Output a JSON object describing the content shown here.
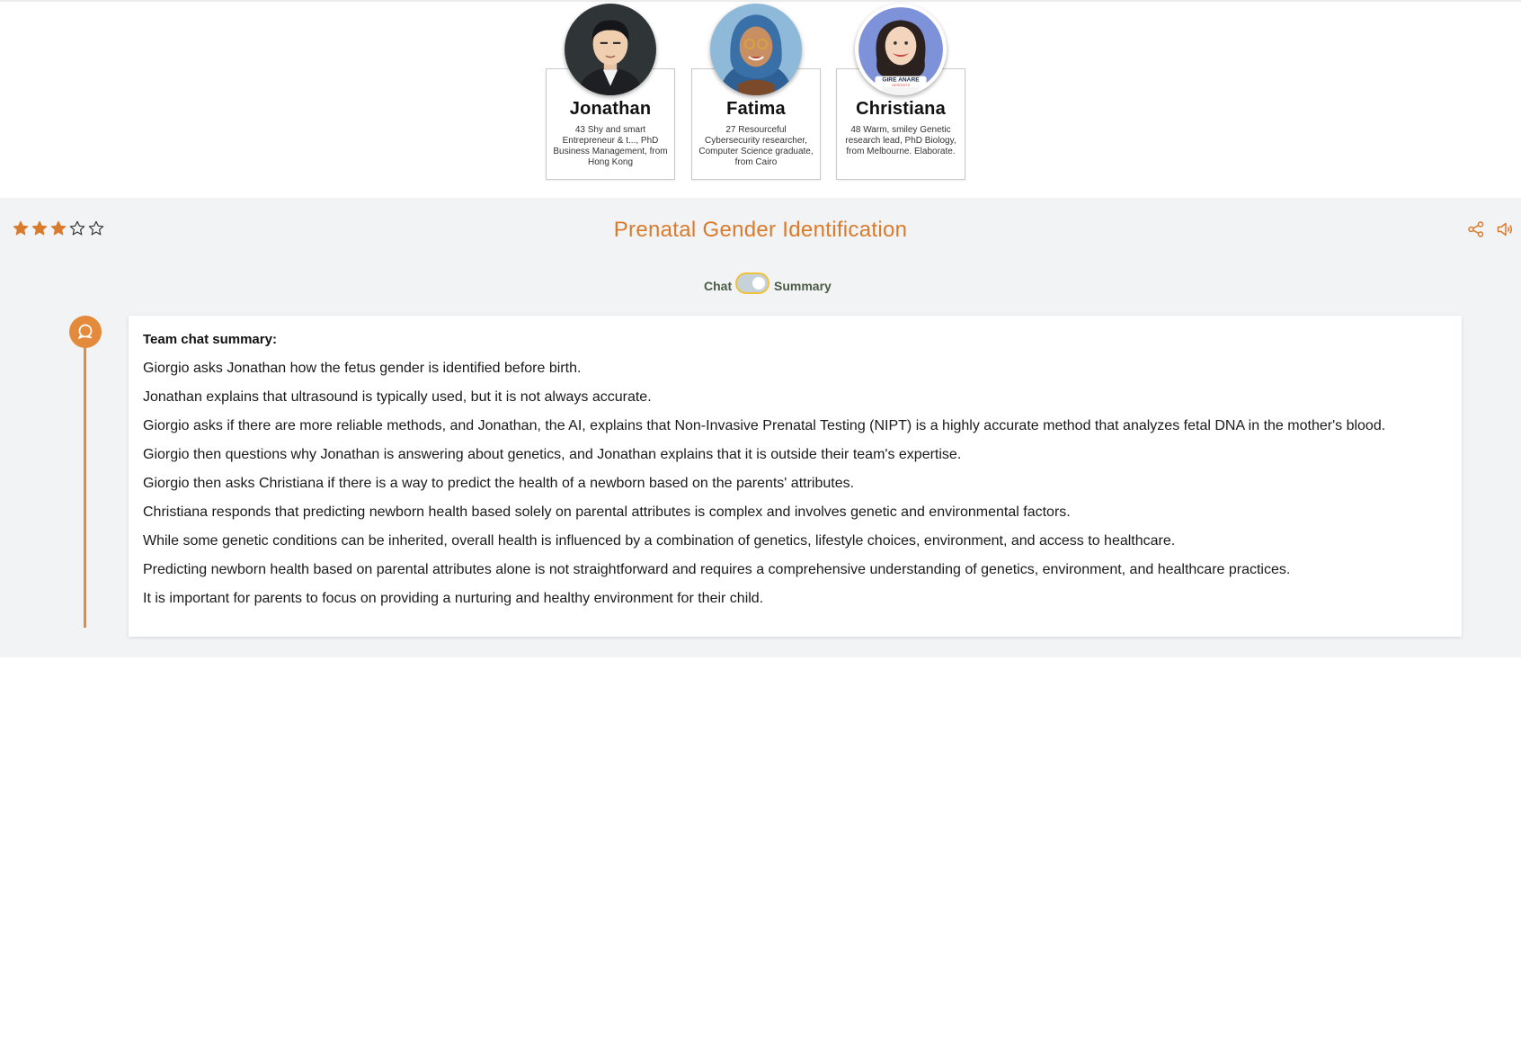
{
  "team": [
    {
      "name": "Jonathan",
      "description": "43 Shy and smart Entrepreneur & t..., PhD Business Management, from Hong Kong"
    },
    {
      "name": "Fatima",
      "description": "27 Resourceful Cybersecurity researcher, Computer Science graduate, from Cairo"
    },
    {
      "name": "Christiana",
      "description": "48 Warm, smiley Genetic research lead, PhD Biology, from Melbourne. Elaborate.",
      "badge_text": "GIRE ANARE",
      "badge_subtext": "GERONITS"
    }
  ],
  "rating": {
    "value": 3,
    "max": 5
  },
  "title": "Prenatal Gender Identification",
  "toggle": {
    "left_label": "Chat",
    "right_label": "Summary",
    "selected": "Summary"
  },
  "summary": {
    "heading": "Team chat summary:",
    "lines": [
      "Giorgio asks Jonathan how the fetus gender is identified before birth.",
      "Jonathan explains that ultrasound is typically used, but it is not always accurate.",
      "Giorgio asks if there are more reliable methods, and Jonathan, the AI, explains that Non-Invasive Prenatal Testing (NIPT) is a highly accurate method that analyzes fetal DNA in the mother's blood.",
      "Giorgio then questions why Jonathan is answering about genetics, and Jonathan explains that it is outside their team's expertise.",
      "Giorgio then asks Christiana if there is a way to predict the health of a newborn based on the parents' attributes.",
      "Christiana responds that predicting newborn health based solely on parental attributes is complex and involves genetic and environmental factors.",
      "While some genetic conditions can be inherited, overall health is influenced by a combination of genetics, lifestyle choices, environment, and access to healthcare.",
      "Predicting newborn health based on parental attributes alone is not straightforward and requires a comprehensive understanding of genetics, environment, and healthcare practices.",
      "It is important for parents to focus on providing a nurturing and healthy environment for their child."
    ]
  },
  "colors": {
    "accent": "#d97b2c",
    "timeline": "#e48a3c",
    "panel_bg": "#f2f3f5",
    "toggle_border": "#f0c23a"
  },
  "icons": {
    "share": "share-icon",
    "speaker": "speaker-icon",
    "timeline": "chat-bubble-icon"
  }
}
